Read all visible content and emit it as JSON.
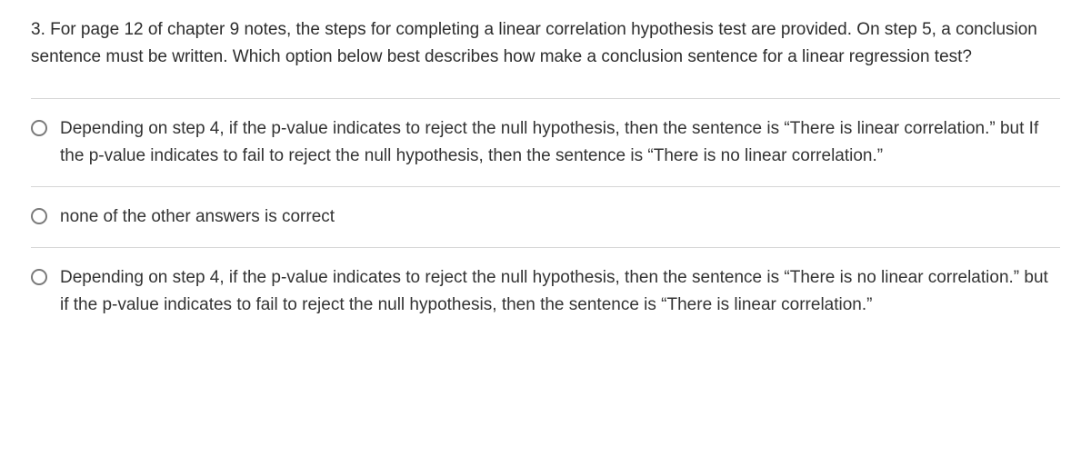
{
  "question": {
    "prompt": "3. For page 12 of chapter 9 notes, the steps for completing a linear correlation hypothesis test are provided. On step 5, a conclusion sentence must be written. Which option below best describes how make a conclusion sentence for a linear regression test?"
  },
  "options": [
    {
      "text": "Depending on step 4, if the p-value indicates to reject the null hypothesis, then the sentence is “There is linear correlation.” but If the p-value indicates to fail to reject the null hypothesis, then the sentence is “There is no linear correlation.”"
    },
    {
      "text": "none of the other answers is correct"
    },
    {
      "text": "Depending on step 4, if the p-value indicates to reject the null hypothesis, then the sentence is “There is no linear correlation.” but if the p-value indicates to fail to reject the null hypothesis, then the sentence is “There is linear correlation.”"
    }
  ]
}
